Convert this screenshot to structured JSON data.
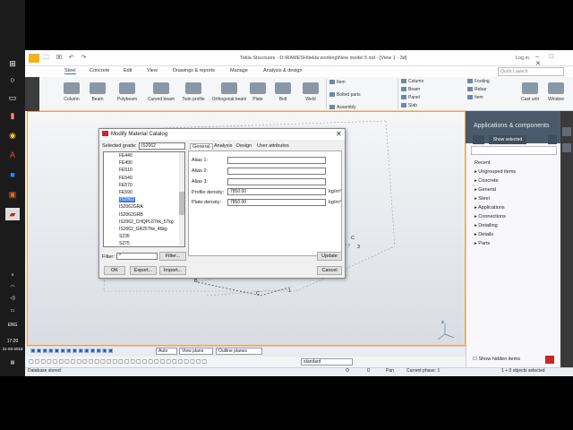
{
  "taskbar": {
    "time": "17:20",
    "date": "31-03-2018",
    "lang": "ENG"
  },
  "window": {
    "title": "Tekla Structures - D:\\RAMESH\\tekla working\\New model 5 ind  - [View 1 - 3d]",
    "login": "Log in"
  },
  "ribbon_tabs": [
    "Steel",
    "Concrete",
    "Edit",
    "View",
    "Drawings & reports",
    "Manage",
    "Analysis & design"
  ],
  "quick_launch_placeholder": "Quick Launch",
  "ribbon": {
    "buttons": [
      "Column",
      "Beam",
      "Polybeam",
      "Curved beam",
      "Twin profile",
      "Orthogonal beam",
      "Plate",
      "Bolt",
      "Weld"
    ],
    "small_left": [
      "Item",
      "Bolted parts",
      "Assembly"
    ],
    "concrete_small": [
      "Column",
      "Beam",
      "Panel",
      "Slab"
    ],
    "concrete_small2": [
      "Footing",
      "Rebar",
      "Item"
    ],
    "extra_buttons": [
      "Cast unit",
      "Window"
    ]
  },
  "view_labels": {
    "c_top": "C",
    "num_3": "3",
    "b": "B",
    "c_bottom": "C",
    "num_1": "1"
  },
  "side_panel": {
    "title": "Applications & components",
    "show_selected": "Show selected",
    "items": [
      "Recent",
      "Ungrouped items",
      "Concrete",
      "General",
      "Steel",
      "Applications",
      "Connections",
      "Detailing",
      "Details",
      "Parts"
    ],
    "hidden_items": "Show hidden items"
  },
  "bottom_toolbar": {
    "auto": "Auto",
    "view_plane": "View plane",
    "outline_planes": "Outline planes",
    "standard": "standard"
  },
  "status": {
    "left": "Database stored",
    "o1": "O",
    "o2": "0",
    "pan": "Pan",
    "phase": "Current phase: 1",
    "selected": "1 + 0 objects selected"
  },
  "dialog": {
    "title": "Modify Material Catalog",
    "selected_grade_label": "Selected grade:",
    "selected_grade_value": "IS2062",
    "tabs": [
      "General",
      "Analysis",
      "Design",
      "User attributes"
    ],
    "tree": [
      "FE440",
      "FE490",
      "FE510",
      "FE540",
      "FE570",
      "FE590",
      "IS2062",
      "IS2062GRA",
      "IS2062GRB",
      "IS2062_CHQPL6Thk_57kg",
      "IS2062_GR25Thk_46kg",
      "S235",
      "S275"
    ],
    "tree_selected_index": 6,
    "fields": {
      "alias1_label": "Alias 1:",
      "alias2_label": "Alias 2:",
      "alias3_label": "Alias 3:",
      "profile_density_label": "Profile density:",
      "profile_density_value": "7850.00",
      "plate_density_label": "Plate density:",
      "plate_density_value": "7850.00",
      "unit": "kg/m³"
    },
    "filter_label": "Filter:",
    "filter_value": "*",
    "buttons": {
      "filter": "Filter...",
      "update": "Update",
      "ok": "OK",
      "export": "Export...",
      "import": "Import...",
      "cancel": "Cancel"
    }
  }
}
